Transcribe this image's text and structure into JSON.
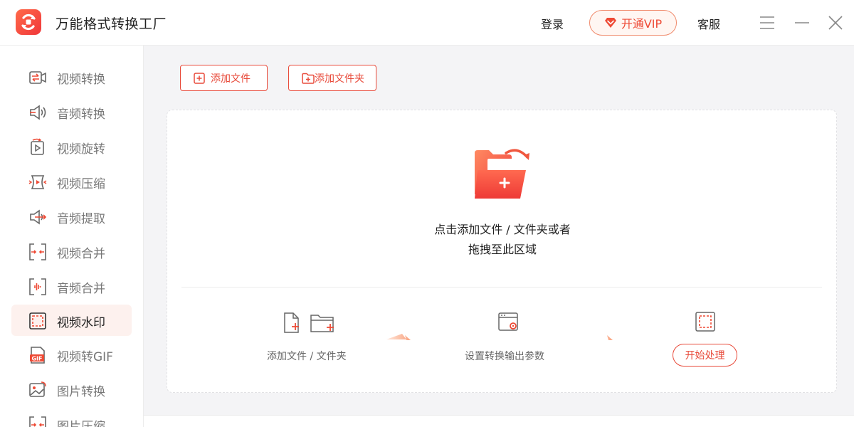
{
  "app": {
    "title": "万能格式转换工厂",
    "accent": "#ee4a35"
  },
  "header": {
    "login_label": "登录",
    "vip_label": "开通VIP",
    "service_label": "客服"
  },
  "sidebar": {
    "items": [
      {
        "label": "视频转换",
        "icon": "video-convert-icon"
      },
      {
        "label": "音频转换",
        "icon": "audio-convert-icon"
      },
      {
        "label": "视频旋转",
        "icon": "video-rotate-icon"
      },
      {
        "label": "视频压缩",
        "icon": "video-compress-icon"
      },
      {
        "label": "音频提取",
        "icon": "audio-extract-icon"
      },
      {
        "label": "视频合并",
        "icon": "video-merge-icon"
      },
      {
        "label": "音频合并",
        "icon": "audio-merge-icon"
      },
      {
        "label": "视频水印",
        "icon": "video-watermark-icon",
        "active": true
      },
      {
        "label": "视频转GIF",
        "icon": "gif-icon"
      },
      {
        "label": "图片转换",
        "icon": "image-convert-icon"
      },
      {
        "label": "图片压缩",
        "icon": "image-compress-icon"
      }
    ],
    "gif_badge": "GIF"
  },
  "toolbar": {
    "add_file_label": "添加文件",
    "add_folder_label": "添加文件夹"
  },
  "dropzone": {
    "line1": "点击添加文件 / 文件夹或者",
    "line2": "拖拽至此区域"
  },
  "steps": {
    "step1_label": "添加文件 / 文件夹",
    "step2_label": "设置转换输出参数",
    "start_label": "开始处理"
  }
}
